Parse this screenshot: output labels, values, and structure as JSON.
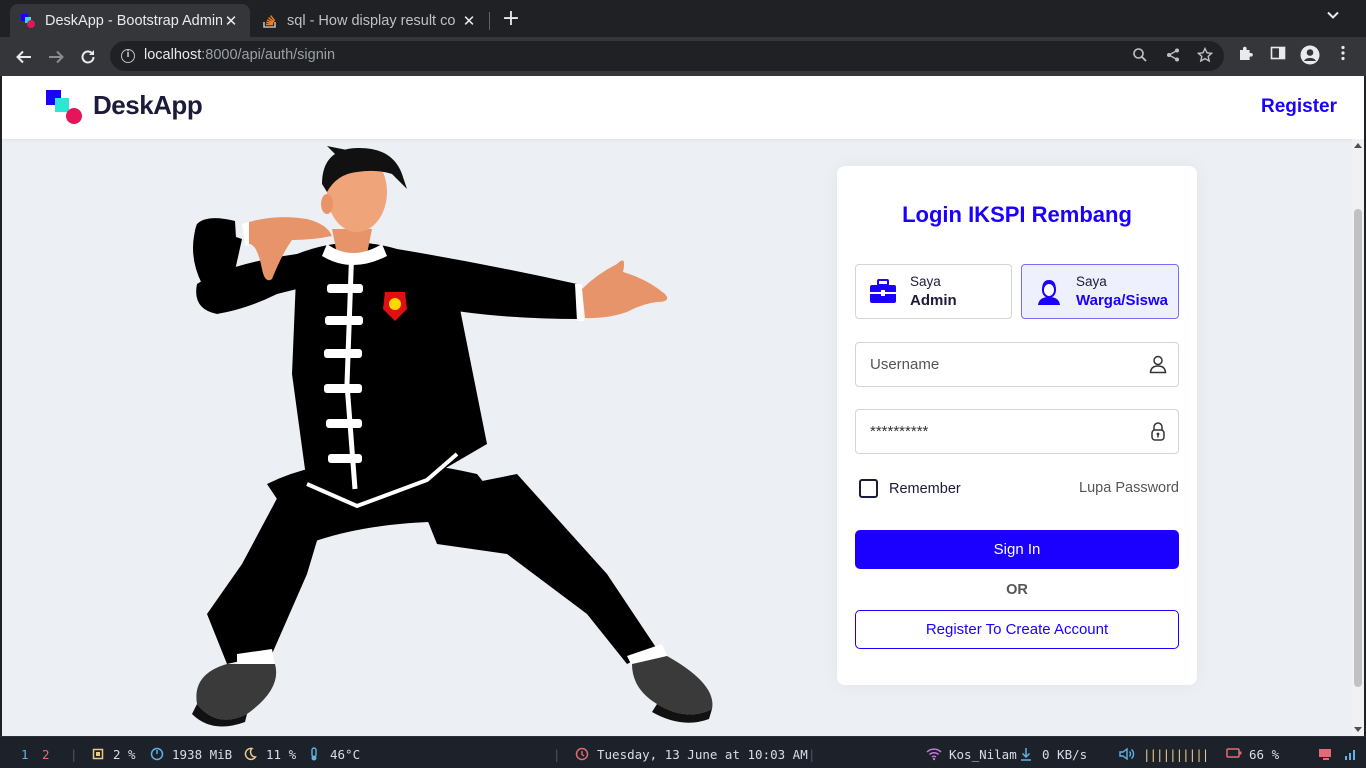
{
  "browser": {
    "tabs": [
      {
        "title": "DeskApp - Bootstrap Admin",
        "active": true,
        "close": "✕"
      },
      {
        "title": "sql - How display result co",
        "active": false,
        "close": "✕"
      }
    ],
    "new_tab": "+",
    "url_host": "localhost",
    "url_rest": ":8000/api/auth/signin"
  },
  "header": {
    "brand": "DeskApp",
    "register_link": "Register"
  },
  "login": {
    "title": "Login IKSPI Rembang",
    "roles": [
      {
        "small": "Saya",
        "big": "Admin",
        "icon": "briefcase-icon",
        "selected": false
      },
      {
        "small": "Saya",
        "big": "Warga/Siswa",
        "icon": "person-icon",
        "selected": true
      }
    ],
    "username_placeholder": "Username",
    "password_value": "**********",
    "remember_label": "Remember",
    "forgot_label": "Lupa Password",
    "signin_label": "Sign In",
    "or_label": "OR",
    "register_button_label": "Register To Create Account"
  },
  "colors": {
    "accent": "#1b00ff",
    "page_bg": "#ecf0f4",
    "card_bg": "#ffffff"
  },
  "statusbar": {
    "ws1": "1",
    "ws2": "2",
    "sep": "|",
    "cpu": "2 %",
    "mem": "1938 MiB",
    "load": "11 %",
    "temp": "46°C",
    "datetime": "Tuesday, 13 June at 10:03 AM",
    "wifi": "Kos_Nilam",
    "net": "0 KB/s",
    "volume_bars": "||||||||||",
    "battery": "66 %"
  }
}
